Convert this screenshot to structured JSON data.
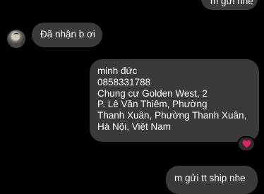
{
  "messages": {
    "top_outgoing": "m gửi nhé",
    "incoming": "Đã nhận b ơi",
    "address": "minh đức\n0858331788\nChung cư Golden West, 2\nP. Lê Văn Thiêm, Phường\nThanh Xuân, Phường Thanh Xuân,\nHà Nội, Việt Nam",
    "bottom_outgoing": "m gửi tt ship nhe"
  },
  "reaction": {
    "icon": "heart-icon",
    "color": "#e0245e"
  },
  "colors": {
    "background": "#000000",
    "bubble": "#3a3a3c",
    "text": "#ffffff"
  }
}
